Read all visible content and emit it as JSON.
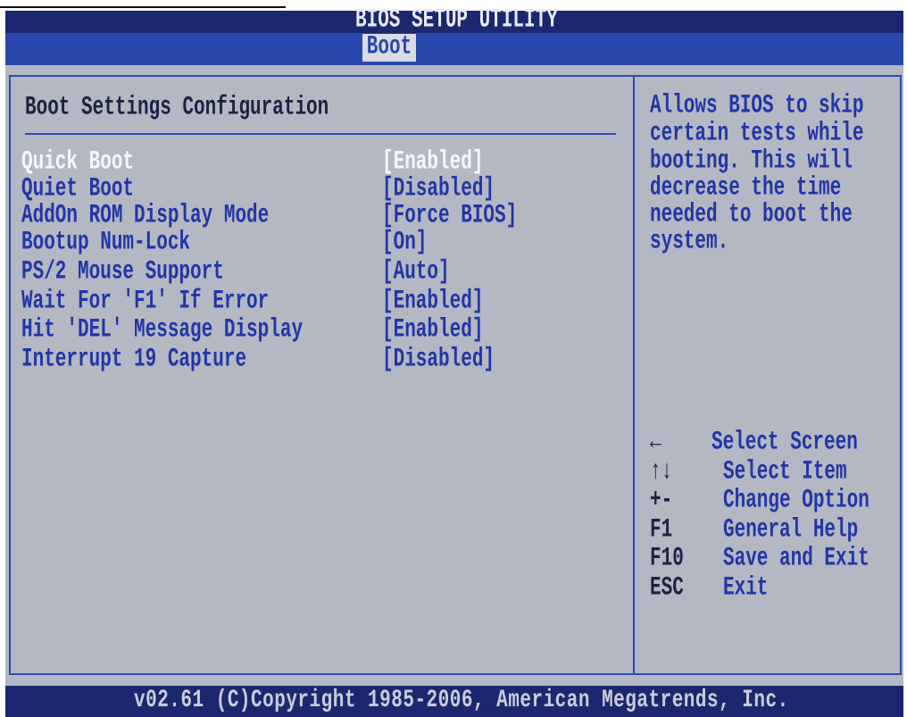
{
  "window": {
    "title": "BIOS SETUP UTILITY"
  },
  "menu": {
    "tabs": [
      {
        "label": "Boot",
        "selected": true
      }
    ]
  },
  "main": {
    "section_title": "Boot Settings Configuration",
    "items": [
      {
        "label": "Quick Boot",
        "value": "[Enabled]",
        "selected": true
      },
      {
        "label": "Quiet Boot",
        "value": "[Disabled]",
        "selected": false
      },
      {
        "label": "AddOn ROM Display Mode",
        "value": "[Force BIOS]",
        "selected": false
      },
      {
        "label": "Bootup Num-Lock",
        "value": "[On]",
        "selected": false
      },
      {
        "label": "PS/2 Mouse Support",
        "value": "[Auto]",
        "selected": false
      },
      {
        "label": "Wait For 'F1' If Error",
        "value": "[Enabled]",
        "selected": false
      },
      {
        "label": "Hit 'DEL' Message Display",
        "value": "[Enabled]",
        "selected": false
      },
      {
        "label": "Interrupt 19 Capture",
        "value": "[Disabled]",
        "selected": false
      }
    ]
  },
  "help": {
    "lines": [
      "Allows BIOS to skip",
      "certain tests while",
      "booting. This will",
      "decrease the time",
      "needed to boot the",
      "system."
    ]
  },
  "key_legend": [
    {
      "key": "←",
      "action": "Select Screen"
    },
    {
      "key": "↑↓",
      "action": "Select Item"
    },
    {
      "key": "+-",
      "action": "Change Option"
    },
    {
      "key": "F1",
      "action": "General Help"
    },
    {
      "key": "F10",
      "action": "Save and Exit"
    },
    {
      "key": "ESC",
      "action": "Exit"
    }
  ],
  "footer": {
    "copyright": "v02.61 (C)Copyright 1985-2006, American Megatrends, Inc."
  },
  "theme": {
    "title_bar": "#1b286f",
    "title_text": "#e7eaf2",
    "menu_bar": "#2a47ad",
    "panel": "#b3b8c2",
    "border": "#2d4ab3",
    "text": "#2236a6",
    "text_dark": "#1d2244",
    "highlight": "#f6f7fa",
    "tab_selected_bg": "#d9dce5",
    "footer_text": "#c8cdd9"
  }
}
